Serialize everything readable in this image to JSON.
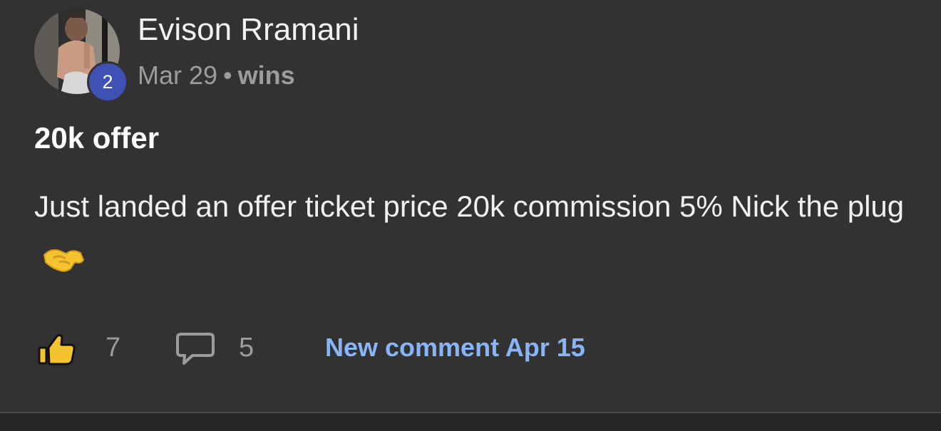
{
  "post": {
    "author": {
      "name": "Evison Rramani",
      "level": "2"
    },
    "meta": {
      "date": "Mar 29",
      "separator": "•",
      "category": "wins"
    },
    "title": "20k offer",
    "body": "Just landed an offer ticket price 20k commission 5% Nick the plug",
    "emoji": "handshake-emoji",
    "actions": {
      "like_icon": "thumbs-up-icon",
      "like_count": "7",
      "comment_icon": "comment-bubble-icon",
      "comment_count": "5",
      "new_comment_label": "New comment Apr 15"
    }
  },
  "colors": {
    "background": "#323232",
    "badge": "#3f51b5",
    "muted": "#9c9c9c",
    "link": "#8ab4f8",
    "emoji": "#f4c430"
  }
}
